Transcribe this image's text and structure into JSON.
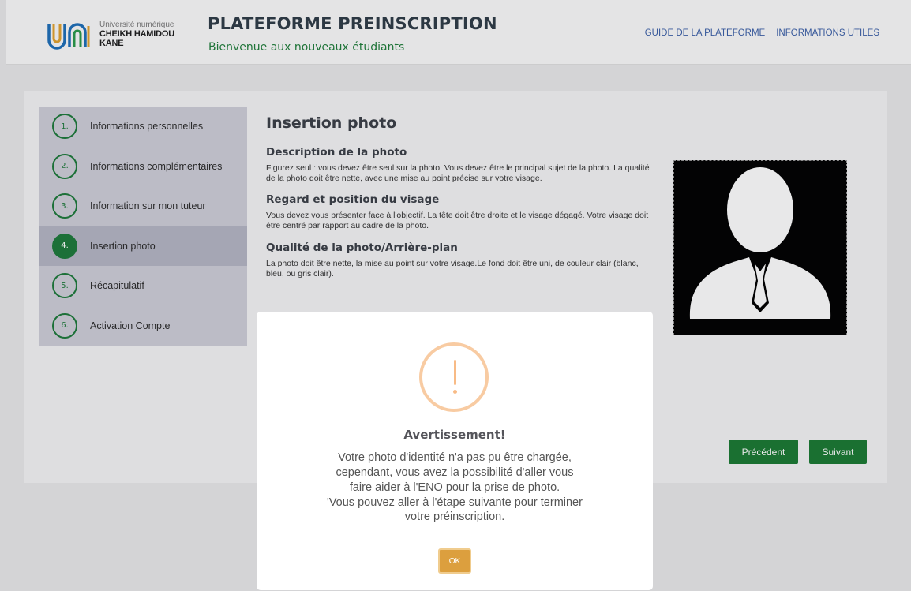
{
  "header": {
    "logo_line1": "Université numérique",
    "logo_line2": "CHEIKH HAMIDOU KANE",
    "title": "PLATEFORME PREINSCRIPTION",
    "subtitle": "Bienvenue aux nouveaux étudiants",
    "nav": [
      "GUIDE DE LA PLATEFORME",
      "INFORMATIONS UTILES"
    ]
  },
  "steps": [
    {
      "num": "1.",
      "label": "Informations personnelles",
      "active": false
    },
    {
      "num": "2.",
      "label": "Informations complémentaires",
      "active": false
    },
    {
      "num": "3.",
      "label": "Information sur mon tuteur",
      "active": false
    },
    {
      "num": "4.",
      "label": "Insertion photo",
      "active": true
    },
    {
      "num": "5.",
      "label": "Récapitulatif",
      "active": false
    },
    {
      "num": "6.",
      "label": "Activation Compte",
      "active": false
    }
  ],
  "content": {
    "title": "Insertion photo",
    "sections": [
      {
        "heading": "Description de la photo",
        "text": "Figurez seul : vous devez être seul sur la photo. Vous devez être le principal sujet de la photo. La qualité de la photo doit être nette, avec une mise au point précise sur votre visage."
      },
      {
        "heading": "Regard et position du visage",
        "text": "Vous devez vous présenter face à l'objectif. La tête doit être droite et le visage dégagé. Votre visage doit être centré par rapport au cadre de la photo."
      },
      {
        "heading": "Qualité de la photo/Arrière-plan",
        "text": "La photo doit être nette, la mise au point sur votre visage.Le fond doit être uni, de couleur clair (blanc, bleu, ou gris clair)."
      }
    ]
  },
  "buttons": {
    "prev": "Précédent",
    "next": "Suivant"
  },
  "modal": {
    "title": "Avertissement!",
    "lines": [
      "Votre photo d'identité n'a pas pu être chargée,",
      "cependant, vous avez la possibilité d'aller vous",
      "faire aider à l'ENO pour la prise de photo.",
      "'Vous pouvez aller à l'étape suivante pour terminer",
      "votre préinscription."
    ],
    "ok": "OK"
  },
  "colors": {
    "accent_green": "#1a7a33",
    "warning": "#f8bb86",
    "ok_button": "#dc9f3e"
  }
}
